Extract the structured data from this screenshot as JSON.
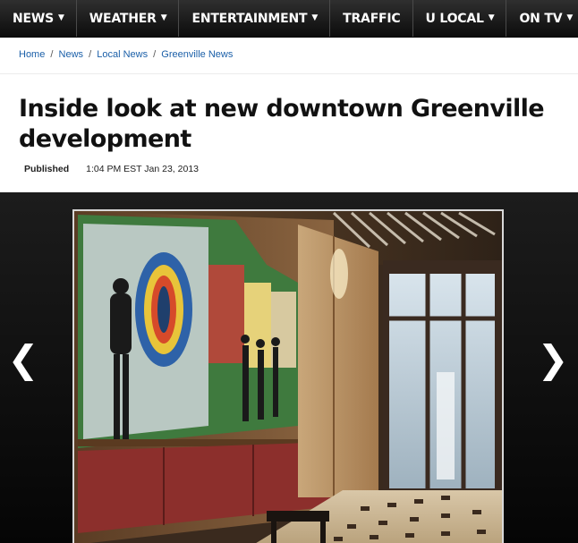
{
  "nav": {
    "items": [
      {
        "label": "NEWS",
        "has_dropdown": true
      },
      {
        "label": "WEATHER",
        "has_dropdown": true
      },
      {
        "label": "ENTERTAINMENT",
        "has_dropdown": true
      },
      {
        "label": "TRAFFIC",
        "has_dropdown": false
      },
      {
        "label": "U LOCAL",
        "has_dropdown": true
      },
      {
        "label": "ON TV",
        "has_dropdown": true
      }
    ],
    "dropdown_icon": "chevron-down-icon"
  },
  "breadcrumb": {
    "items": [
      "Home",
      "News",
      "Local News",
      "Greenville News"
    ],
    "separator": "/"
  },
  "article": {
    "headline": "Inside look at new downtown Greenville development",
    "published_label": "Published",
    "published_time": "1:04 PM EST Jan 23, 2013"
  },
  "gallery": {
    "prev_icon": "chevron-left-icon",
    "next_icon": "chevron-right-icon",
    "prev_glyph": "❮",
    "next_glyph": "❯"
  },
  "colors": {
    "nav_bg": "#1a1a1a",
    "link": "#1a5fa8",
    "gallery_bg": "#0e0e0e"
  }
}
